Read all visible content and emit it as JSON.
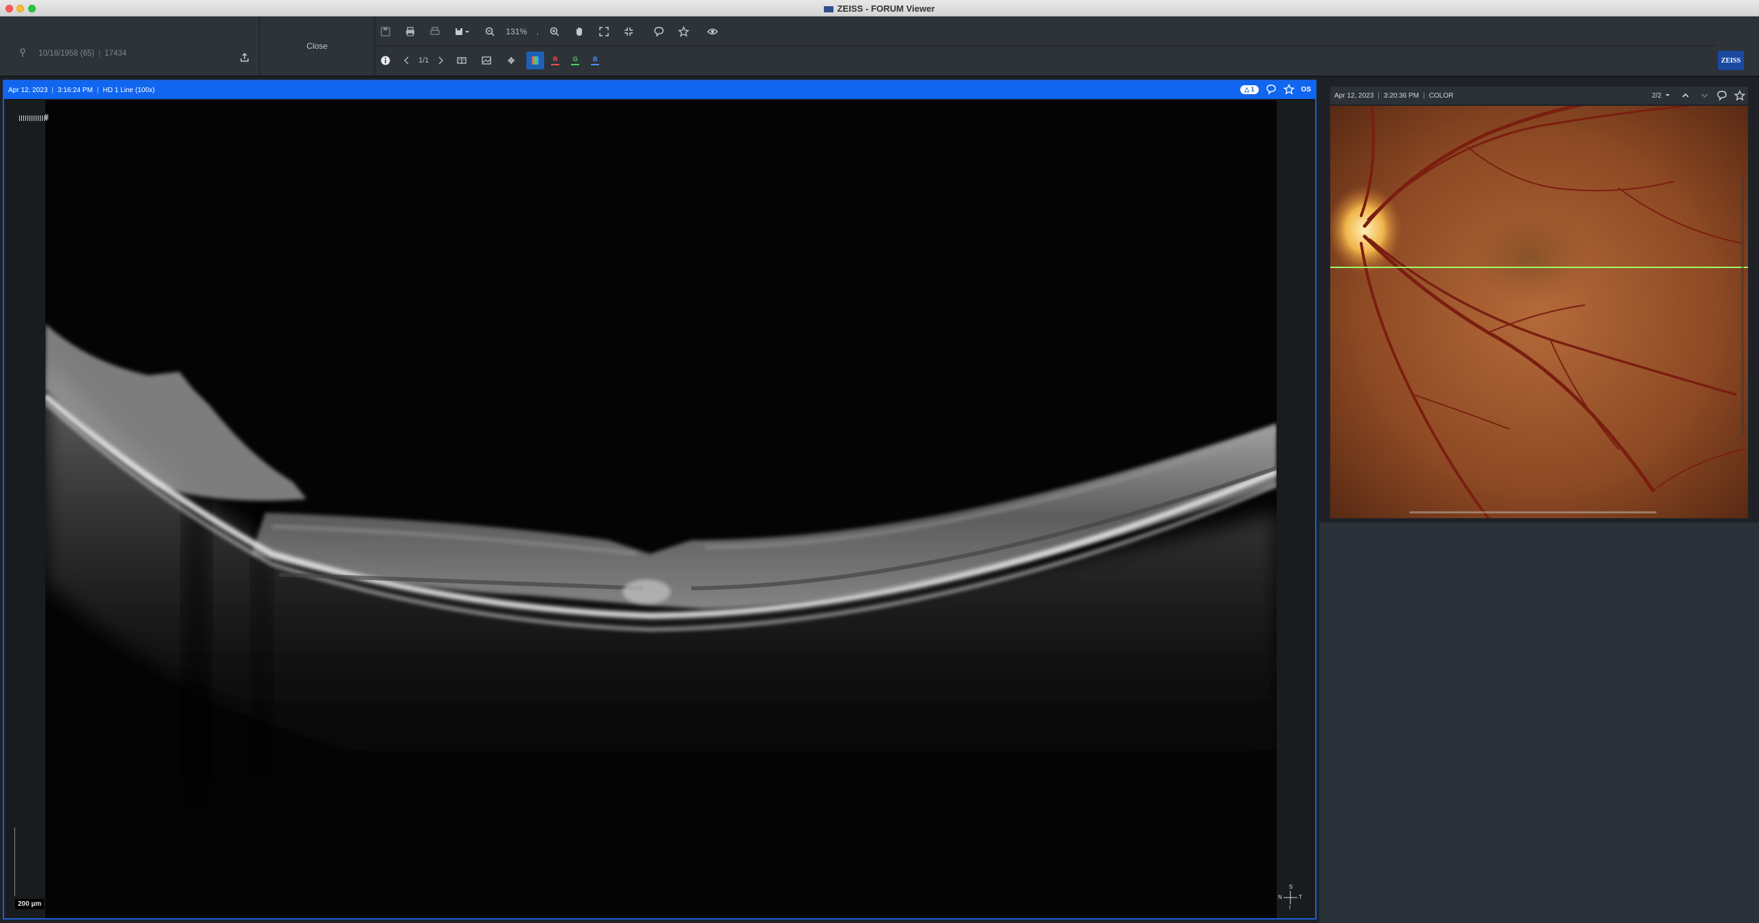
{
  "window": {
    "title": "ZEISS - FORUM Viewer"
  },
  "patient": {
    "dob": "10/16/1958 (65)",
    "id": "17434"
  },
  "toolbar": {
    "close_label": "Close",
    "zoom": "131%",
    "zoom_suffix": ",",
    "page": "1/1",
    "channels": [
      {
        "label": "",
        "color": "#4aa3ff"
      },
      {
        "label": "R",
        "color": "#ff4d4d"
      },
      {
        "label": "G",
        "color": "#4dd06a"
      },
      {
        "label": "B",
        "color": "#4d8dff"
      }
    ]
  },
  "brand": {
    "logo_text": "ZEISS"
  },
  "oct": {
    "date": "Apr 12, 2023",
    "time": "3:16:24 PM",
    "scan": "HD 1 Line (100x)",
    "badge": "1",
    "eye": "OS",
    "scale_label": "200 µm",
    "orientation": {
      "top": "S",
      "left": "N",
      "right": "T",
      "bottom": "I"
    }
  },
  "fundus": {
    "date": "Apr 12, 2023",
    "time": "3:20:36 PM",
    "mode": "COLOR",
    "counter": "2/2"
  },
  "colors": {
    "accent": "#1066f0",
    "scanline": "#9eff6a"
  }
}
